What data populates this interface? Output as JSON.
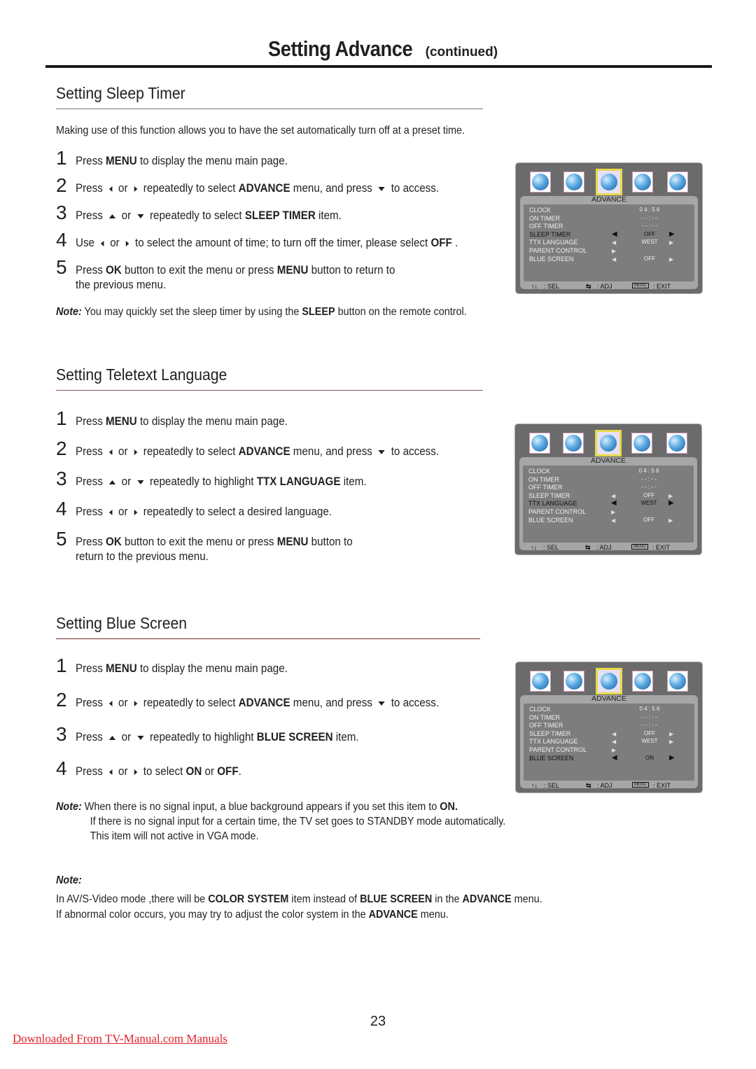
{
  "header": {
    "title": "Setting Advance",
    "subtitle": "(continued)"
  },
  "sections": [
    {
      "title": "Setting Sleep Timer",
      "intro": "Making use of this function allows you to have the set automatically turn off at a preset time.",
      "steps": [
        {
          "n": "1",
          "parts": [
            "Press ",
            {
              "b": "MENU"
            },
            " to display the menu main page."
          ]
        },
        {
          "n": "2",
          "parts": [
            "Press ",
            {
              "i": "left"
            },
            " or ",
            {
              "i": "right"
            },
            " repeatedly to select ",
            {
              "b": "ADVANCE"
            },
            " menu, and press ",
            {
              "i": "down"
            },
            " to access."
          ]
        },
        {
          "n": "3",
          "parts": [
            "Press ",
            {
              "i": "up"
            },
            " or ",
            {
              "i": "down"
            },
            " repeatedly to select ",
            {
              "b": "SLEEP TIMER"
            },
            " item."
          ]
        },
        {
          "n": "4",
          "parts": [
            "Use ",
            {
              "i": "left"
            },
            " or ",
            {
              "i": "right"
            },
            " to select the amount of time; to turn off the timer, please select ",
            {
              "b": "OFF"
            },
            " ."
          ]
        },
        {
          "n": "5",
          "parts": [
            "Press ",
            {
              "b": "OK"
            },
            " button to exit the menu  or press ",
            {
              "b": "MENU"
            },
            " button to return to"
          ],
          "line2": "the previous menu."
        }
      ],
      "note": {
        "label": "Note:",
        "parts": [
          " You may quickly set the sleep timer by using the ",
          {
            "b": "SLEEP"
          },
          " button on the remote control."
        ]
      }
    },
    {
      "title": "Setting Teletext Language",
      "steps": [
        {
          "n": "1",
          "parts": [
            "Press ",
            {
              "b": "MENU"
            },
            " to display the menu main page."
          ]
        },
        {
          "n": "2",
          "parts": [
            "Press ",
            {
              "i": "left"
            },
            " or ",
            {
              "i": "right"
            },
            " repeatedly to select ",
            {
              "b": "ADVANCE"
            },
            " menu, and press ",
            {
              "i": "down"
            },
            " to access."
          ]
        },
        {
          "n": "3",
          "parts": [
            "Press ",
            {
              "i": "up"
            },
            " or ",
            {
              "i": "down"
            },
            " repeatedly to highlight ",
            {
              "b": "TTX LANGUAGE"
            },
            " item."
          ]
        },
        {
          "n": "4",
          "parts": [
            "Press ",
            {
              "i": "left"
            },
            " or ",
            {
              "i": "right"
            },
            " repeatedly to select a desired language."
          ]
        },
        {
          "n": "5",
          "parts": [
            "Press ",
            {
              "b": "OK"
            },
            " button to exit the menu  or press ",
            {
              "b": "MENU"
            },
            " button to"
          ],
          "line2": "return to the previous menu."
        }
      ]
    },
    {
      "title": "Setting Blue Screen",
      "steps": [
        {
          "n": "1",
          "parts": [
            "Press ",
            {
              "b": "MENU"
            },
            " to display the menu main page."
          ]
        },
        {
          "n": "2",
          "parts": [
            "Press ",
            {
              "i": "left"
            },
            " or ",
            {
              "i": "right"
            },
            " repeatedly to select ",
            {
              "b": "ADVANCE"
            },
            " menu, and press ",
            {
              "i": "down"
            },
            " to access."
          ]
        },
        {
          "n": "3",
          "parts": [
            "Press ",
            {
              "i": "up"
            },
            " or ",
            {
              "i": "down"
            },
            " repeatedly to highlight ",
            {
              "b": "BLUE SCREEN"
            },
            " item."
          ]
        },
        {
          "n": "4",
          "parts": [
            "Press ",
            {
              "i": "left"
            },
            " or ",
            {
              "i": "right"
            },
            " to select ",
            {
              "b": "ON"
            },
            " or ",
            {
              "b": "OFF"
            },
            "."
          ]
        }
      ],
      "note": {
        "label": "Note:",
        "parts": [
          "  When there is no signal input, a blue background appears if you set this item to ",
          {
            "b": "ON."
          }
        ],
        "line2": "If there is no signal input for a certain time, the TV set goes to STANDBY mode  automatically.",
        "line3": "This item will not active in VGA mode."
      }
    }
  ],
  "final_note": {
    "label": "Note:",
    "line1": [
      "In AV/S-Video mode ,there will be  ",
      {
        "b": "COLOR SYSTEM"
      },
      " item instead of ",
      {
        "b": "BLUE SCREEN"
      },
      " in the ",
      {
        "b": "ADVANCE"
      },
      " menu."
    ],
    "line2": [
      "If abnormal color occurs, you may try to adjust the color system in the ",
      {
        "b": "ADVANCE"
      },
      " menu."
    ]
  },
  "osd": {
    "icons": [
      "picture-icon",
      "sound-icon",
      "advance-icon",
      "screen-icon",
      "search-icon"
    ],
    "selected_icon": 2,
    "title": "ADVANCE",
    "rows_labels": [
      "CLOCK",
      "ON TIMER",
      "OFF TIMER",
      "SLEEP TIMER",
      "TTX LANGUAGE",
      "PARENT CONTROL",
      "BLUE SCREEN"
    ],
    "footer": {
      "sel": ": SEL",
      "adj": ": ADJ",
      "menu_key": "MENU",
      "exit": ": EXIT"
    },
    "screens": [
      {
        "highlight": 3,
        "values": [
          "0 4 : 5 6",
          "- - : - -",
          "- - : - -",
          "OFF",
          "WEST",
          "",
          "OFF"
        ]
      },
      {
        "highlight": 4,
        "values": [
          "0 4 : 5 6",
          "- - : - -",
          "- - : - -",
          "OFF",
          "WEST",
          "",
          "OFF"
        ]
      },
      {
        "highlight": 6,
        "values": [
          "0 4 : 5 6",
          "- - : - -",
          "- - : - -",
          "OFF",
          "WEST",
          "",
          "ON"
        ]
      }
    ]
  },
  "footer": {
    "page_number": "23",
    "source_link": "Downloaded From TV-Manual.com Manuals"
  },
  "colors": {
    "section_rule": "#7a3a3a",
    "link": "#e0242c",
    "osd_bg": "#6b6b6b",
    "osd_select": "#e8d84a"
  }
}
